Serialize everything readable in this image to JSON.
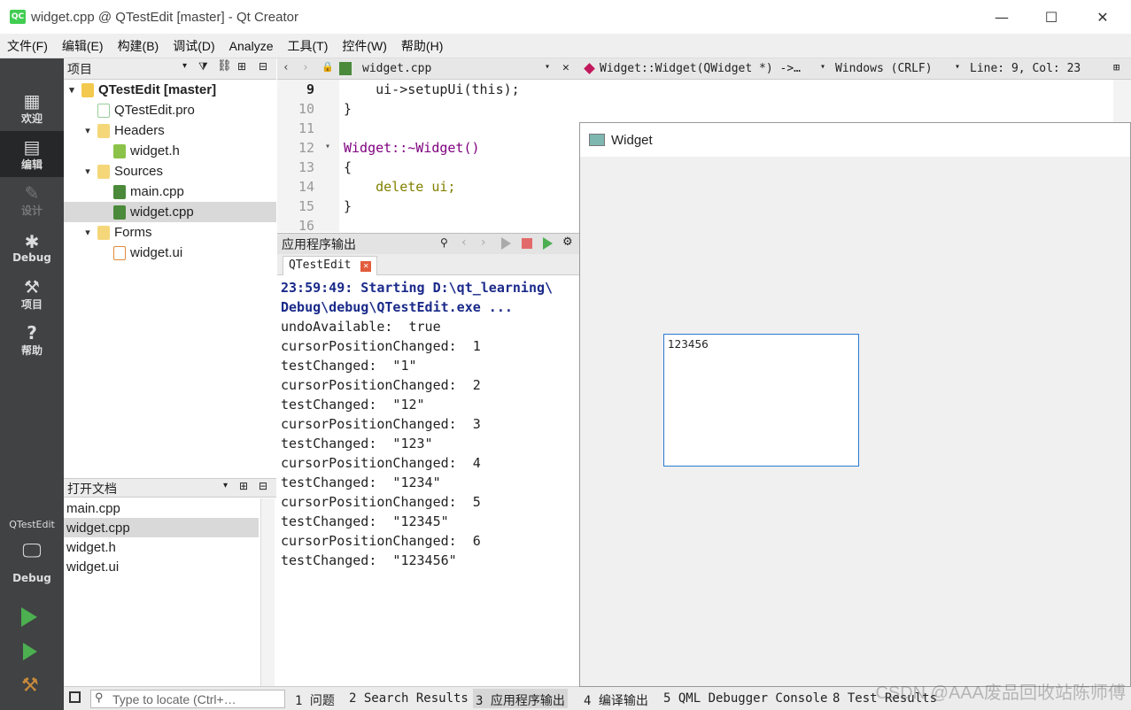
{
  "window": {
    "title": "widget.cpp @ QTestEdit [master] - Qt Creator",
    "logo": "QC"
  },
  "menu": [
    "文件(F)",
    "编辑(E)",
    "构建(B)",
    "调试(D)",
    "Analyze",
    "工具(T)",
    "控件(W)",
    "帮助(H)"
  ],
  "modes": [
    "欢迎",
    "编辑",
    "设计",
    "Debug",
    "项目",
    "帮助"
  ],
  "kit": {
    "project": "QTestEdit",
    "config": "Debug"
  },
  "project_panel": {
    "title": "项目",
    "tree": [
      {
        "label": "QTestEdit [master]",
        "level": 0,
        "chev": "▾",
        "icon": "project-icon"
      },
      {
        "label": "QTestEdit.pro",
        "level": 1,
        "chev": "",
        "icon": "pro-file-icon"
      },
      {
        "label": "Headers",
        "level": 1,
        "chev": "▾",
        "icon": "headers-folder-icon"
      },
      {
        "label": "widget.h",
        "level": 2,
        "chev": "",
        "icon": "header-file-icon"
      },
      {
        "label": "Sources",
        "level": 1,
        "chev": "▾",
        "icon": "sources-folder-icon"
      },
      {
        "label": "main.cpp",
        "level": 2,
        "chev": "",
        "icon": "cpp-file-icon"
      },
      {
        "label": "widget.cpp",
        "level": 2,
        "chev": "",
        "icon": "cpp-file-icon",
        "selected": true
      },
      {
        "label": "Forms",
        "level": 1,
        "chev": "▾",
        "icon": "forms-folder-icon"
      },
      {
        "label": "widget.ui",
        "level": 2,
        "chev": "",
        "icon": "ui-file-icon"
      }
    ]
  },
  "open_docs": {
    "title": "打开文档",
    "items": [
      {
        "label": "main.cpp"
      },
      {
        "label": "widget.cpp",
        "selected": true
      },
      {
        "label": "widget.h"
      },
      {
        "label": "widget.ui"
      }
    ]
  },
  "editor": {
    "file": "widget.cpp",
    "symbol": "Widget::Widget(QWidget *) ->…",
    "encoding": "Windows (CRLF)",
    "position": "Line: 9, Col: 23",
    "lines": [
      {
        "n": "9",
        "text": "    ui->setupUi(this);"
      },
      {
        "n": "10",
        "text": "}"
      },
      {
        "n": "11",
        "text": ""
      },
      {
        "n": "12",
        "text": "Widget::~Widget()"
      },
      {
        "n": "13",
        "text": "{"
      },
      {
        "n": "14",
        "text": "    delete ui;"
      },
      {
        "n": "15",
        "text": "}"
      },
      {
        "n": "16",
        "text": ""
      }
    ]
  },
  "output": {
    "title": "应用程序输出",
    "tab": "QTestEdit",
    "lines": [
      "23:59:49: Starting D:\\qt_learning\\",
      "Debug\\debug\\QTestEdit.exe ...",
      "undoAvailable:  true",
      "cursorPositionChanged:  1",
      "testChanged:  \"1\"",
      "cursorPositionChanged:  2",
      "testChanged:  \"12\"",
      "cursorPositionChanged:  3",
      "testChanged:  \"123\"",
      "cursorPositionChanged:  4",
      "testChanged:  \"1234\"",
      "cursorPositionChanged:  5",
      "testChanged:  \"12345\"",
      "cursorPositionChanged:  6",
      "testChanged:  \"123456\""
    ]
  },
  "statusbar": {
    "locator_placeholder": "Type to locate (Ctrl+…",
    "panes": [
      "1 问题",
      "2 Search Results",
      "3 应用程序输出",
      "4 编译输出",
      "5 QML Debugger Console",
      "8 Test Results"
    ]
  },
  "widget_window": {
    "title": "Widget",
    "text": "123456"
  },
  "watermark": "CSDN @AAA废品回收站陈师傅"
}
